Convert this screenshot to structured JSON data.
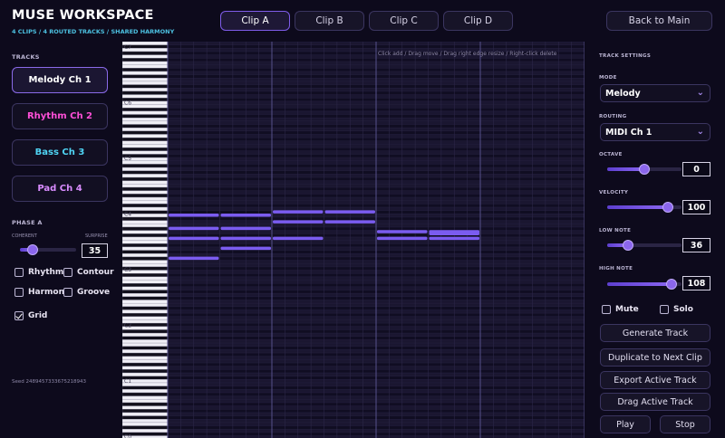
{
  "header": {
    "title": "MUSE WORKSPACE",
    "subtitle": "4 CLIPS  /  4 ROUTED TRACKS  /  SHARED HARMONY",
    "clips": [
      "Clip A",
      "Clip B",
      "Clip C",
      "Clip D"
    ],
    "active_clip": 0,
    "back_label": "Back to Main"
  },
  "left": {
    "tracks_label": "TRACKS",
    "tracks": [
      {
        "label": "Melody   Ch 1",
        "color": "#ffffff"
      },
      {
        "label": "Rhythm   Ch 2",
        "color": "#ff4fd8"
      },
      {
        "label": "Bass   Ch 3",
        "color": "#4fd4f4"
      },
      {
        "label": "Pad   Ch 4",
        "color": "#d98cff"
      }
    ],
    "phase_label": "PHASE A",
    "coherent_label": "COHERENT",
    "surprise_label": "SURPRISE",
    "phase_value": "35",
    "phase_fraction": 0.22,
    "toggles": {
      "rhythm": {
        "label": "Rhythm",
        "checked": false
      },
      "contour": {
        "label": "Contour",
        "checked": false
      },
      "harmony": {
        "label": "Harmony",
        "checked": false
      },
      "groove": {
        "label": "Groove",
        "checked": false
      },
      "grid": {
        "label": "Grid",
        "checked": true
      }
    },
    "seed": "Seed 2489457333675218943"
  },
  "roll": {
    "hint": "Click add  /  Drag move  /  Drag right edge resize  /  Right-click delete",
    "octave_labels": [
      "C7",
      "C6",
      "C5",
      "C4",
      "C3",
      "C2",
      "C1",
      "C0"
    ],
    "note_color": "#7b5cf0"
  },
  "right": {
    "settings_label": "TRACK SETTINGS",
    "mode_label": "MODE",
    "mode_value": "Melody",
    "routing_label": "ROUTING",
    "routing_value": "MIDI Ch 1",
    "octave_label": "OCTAVE",
    "octave_value": "0",
    "octave_fraction": 0.5,
    "velocity_label": "VELOCITY",
    "velocity_value": "100",
    "velocity_fraction": 0.82,
    "low_label": "LOW NOTE",
    "low_value": "36",
    "low_fraction": 0.28,
    "high_label": "HIGH NOTE",
    "high_value": "108",
    "high_fraction": 0.86,
    "mute_label": "Mute",
    "solo_label": "Solo",
    "generate_label": "Generate Track",
    "duplicate_label": "Duplicate to Next Clip",
    "export_label": "Export Active Track",
    "drag_label": "Drag Active Track",
    "play_label": "Play",
    "stop_label": "Stop"
  }
}
